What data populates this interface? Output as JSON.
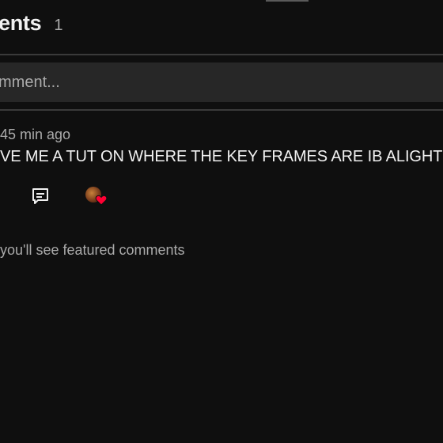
{
  "header": {
    "title": "ents",
    "count": "1"
  },
  "comment_box": {
    "placeholder": "mment..."
  },
  "comment": {
    "meta": "45 min ago",
    "text": "VE ME A TUT ON WHERE THE KEY FRAMES ARE IB ALIGHT",
    "actions": {
      "reply_icon": "reply-icon",
      "creator_heart": "creator-heart-icon"
    }
  },
  "footer": {
    "note": "you'll see featured comments"
  },
  "colors": {
    "background": "#0f0f0f",
    "input_bg": "#272727",
    "text": "#f1f1f1",
    "muted": "#aaaaaa",
    "heart": "#ff0033"
  }
}
